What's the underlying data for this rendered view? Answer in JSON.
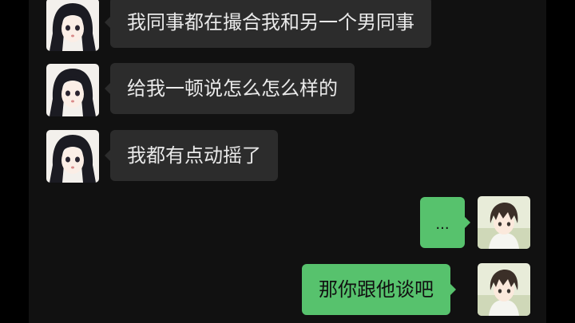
{
  "messages": [
    {
      "sender": "other",
      "avatar": "girl-avatar",
      "text": "我同事都在撮合我和另一个男同事"
    },
    {
      "sender": "other",
      "avatar": "girl-avatar",
      "text": "给我一顿说怎么怎么样的"
    },
    {
      "sender": "other",
      "avatar": "girl-avatar",
      "text": "我都有点动摇了"
    },
    {
      "sender": "self",
      "avatar": "boy-avatar",
      "text": "..."
    },
    {
      "sender": "self",
      "avatar": "boy-avatar",
      "text": "那你跟他谈吧"
    }
  ],
  "colors": {
    "background": "#000000",
    "chat_background": "#111111",
    "incoming_bubble": "#2c2c2c",
    "outgoing_bubble": "#57c26d"
  }
}
